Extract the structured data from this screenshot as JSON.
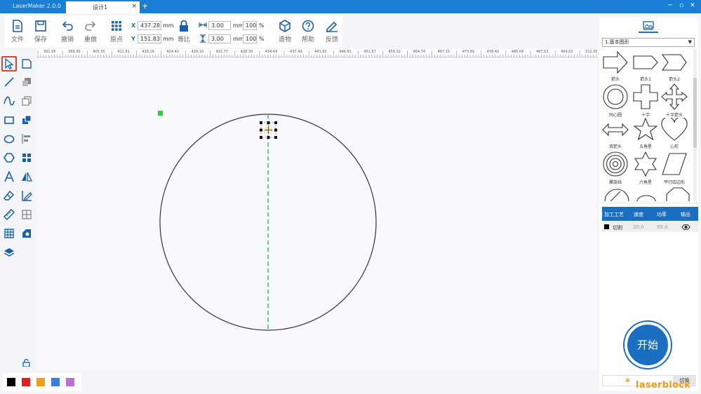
{
  "titlebar": {
    "app_title": "LaserMaker 2.0.0",
    "tab_label": "设计1",
    "tab_close": "×",
    "tab_add": "+",
    "win_min": "─",
    "win_max": "▫",
    "win_close": "✕"
  },
  "toolbar": {
    "file": "文件",
    "save": "保存",
    "undo": "撤销",
    "redo": "重做",
    "anchor": "原点",
    "ratio": "等比",
    "build": "造物",
    "help": "帮助",
    "feedback": "反馈",
    "x_label": "X",
    "y_label": "Y",
    "x_value": "437.28",
    "y_value": "151.83",
    "unit_mm": "mm",
    "width_value": "3.00",
    "height_value": "3.00",
    "width_pct": "100",
    "height_pct": "100",
    "pct": "%"
  },
  "ruler": {
    "labels": [
      "391.95",
      "399.30",
      "405.55",
      "411.91",
      "418.16",
      "424.42",
      "429.10",
      "421.77",
      "428.39",
      "434.64",
      "437.49",
      "441.65",
      "446.91",
      "451.67",
      "459.32",
      "464.74",
      "467.15",
      "473.65",
      "478.42",
      "485.06",
      "487.52",
      "499.02",
      "512.00"
    ]
  },
  "right_panel": {
    "shape_category": "1.基本图形",
    "shapes": [
      {
        "icon": "arrow-icon",
        "label": "箭头"
      },
      {
        "icon": "arrow1-icon",
        "label": "箭头1"
      },
      {
        "icon": "arrow2-icon",
        "label": "箭头2"
      },
      {
        "icon": "ring-icon",
        "label": "同心圆"
      },
      {
        "icon": "cross-icon",
        "label": "十字"
      },
      {
        "icon": "cross-arrow-icon",
        "label": "十字箭头"
      },
      {
        "icon": "double-arrow-icon",
        "label": "双箭头"
      },
      {
        "icon": "star5-icon",
        "label": "五角星"
      },
      {
        "icon": "heart-icon",
        "label": "心形"
      },
      {
        "icon": "spiral-icon",
        "label": "螺旋线"
      },
      {
        "icon": "star6-icon",
        "label": "六角星"
      },
      {
        "icon": "parallelogram-icon",
        "label": "平行四边形"
      }
    ]
  },
  "process": {
    "headers": [
      "加工工艺",
      "速度",
      "功率",
      "输出"
    ],
    "row": {
      "type": "切割",
      "speed": "30.0",
      "power": "99.0"
    },
    "start": "开始",
    "add_label": "",
    "switch": "切换"
  },
  "palette": [
    "#000000",
    "#e02020",
    "#f0a020",
    "#3a7ee0",
    "#c070d0"
  ],
  "watermark": "laserblock"
}
